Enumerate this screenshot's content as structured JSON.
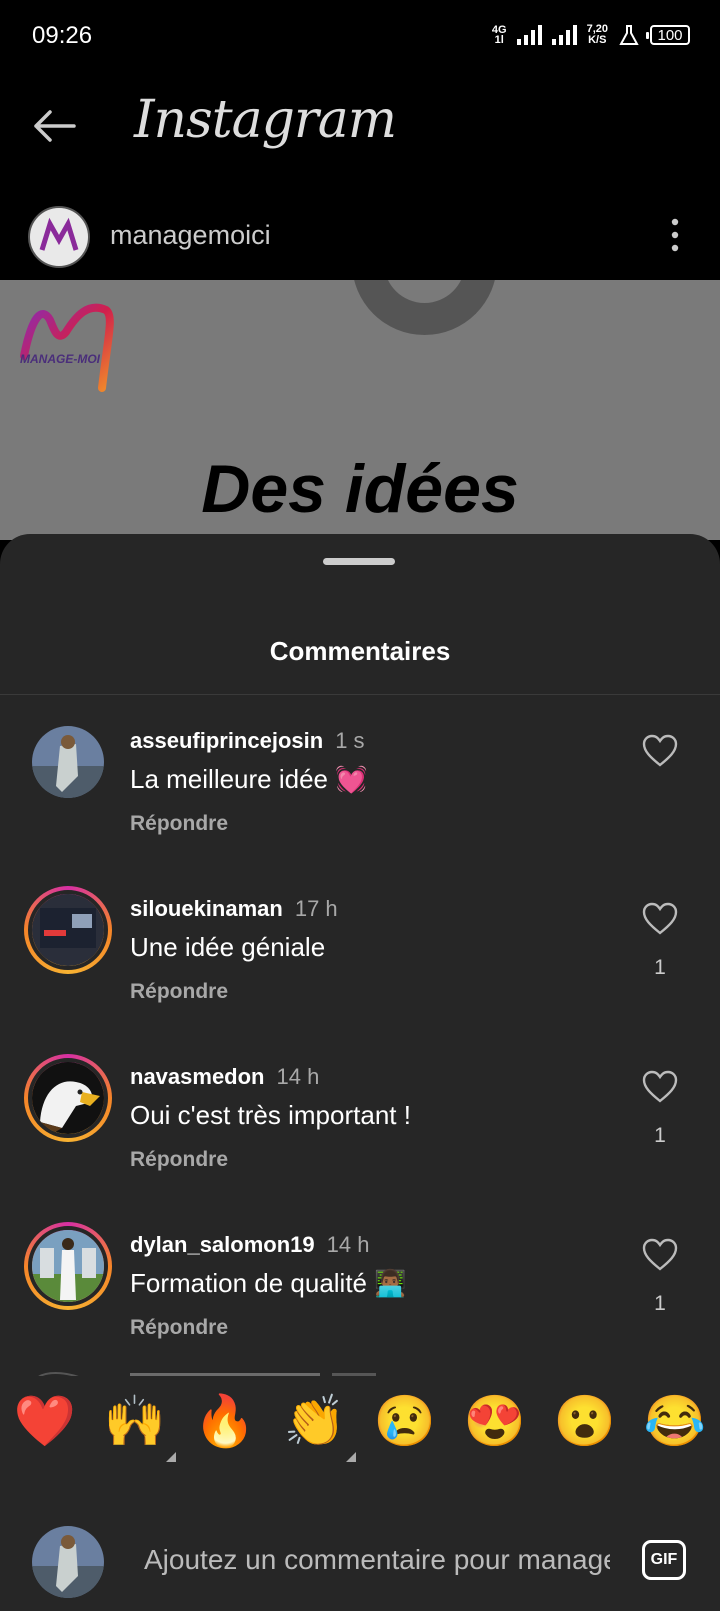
{
  "status_bar": {
    "time": "09:26",
    "network": "4G",
    "net_sub": "1l",
    "speed": "7,20",
    "speed_unit": "K/S",
    "battery": "100"
  },
  "app_bar": {
    "title": "Instagram"
  },
  "post_owner": {
    "username": "managemoici"
  },
  "post_image": {
    "brand": "MANAGE-MOI",
    "headline": "Des idées"
  },
  "sheet": {
    "title": "Commentaires"
  },
  "comments": [
    {
      "username": "asseufiprincejosin",
      "time": "1 s",
      "text": "La meilleure idée 💓",
      "reply": "Répondre",
      "likes": ""
    },
    {
      "username": "silouekinaman",
      "time": "17 h",
      "text": "Une idée géniale",
      "reply": "Répondre",
      "likes": "1"
    },
    {
      "username": "navasmedon",
      "time": "14 h",
      "text": "Oui c'est très important !",
      "reply": "Répondre",
      "likes": "1"
    },
    {
      "username": "dylan_salomon19",
      "time": "14 h",
      "text": "Formation de qualité 👨🏾‍💻",
      "reply": "Répondre",
      "likes": "1"
    }
  ],
  "reactions": [
    "❤️",
    "🙌",
    "🔥",
    "👏",
    "😢",
    "😍",
    "😮",
    "😂"
  ],
  "composer": {
    "placeholder": "Ajoutez un commentaire pour managemoici...",
    "gif_label": "GIF"
  },
  "colors": {
    "sheet_bg": "#262626",
    "muted_text": "#a8a8a8",
    "story_ring_start": "#d62fa4",
    "story_ring_end": "#f58529"
  }
}
